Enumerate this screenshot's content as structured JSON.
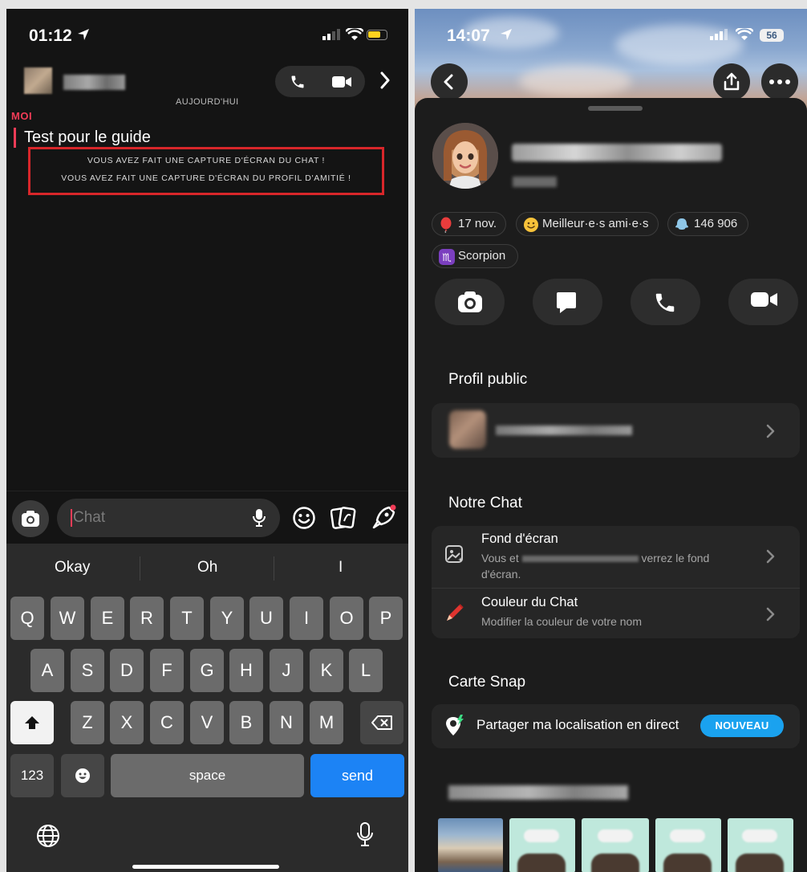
{
  "left_screen": {
    "status": {
      "time": "01:12"
    },
    "chat": {
      "date_label": "AUJOURD'HUI",
      "sender_label": "MOI",
      "message": "Test pour le guide",
      "notice_line1": "VOUS AVEZ FAIT UNE CAPTURE D'ÉCRAN DU CHAT !",
      "notice_line2": "VOUS AVEZ FAIT UNE CAPTURE D'ÉCRAN DU PROFIL D'AMITIÉ !"
    },
    "input": {
      "placeholder": "Chat"
    },
    "keyboard": {
      "suggestions": [
        "Okay",
        "Oh",
        "I"
      ],
      "row1": [
        "Q",
        "W",
        "E",
        "R",
        "T",
        "Y",
        "U",
        "I",
        "O",
        "P"
      ],
      "row2": [
        "A",
        "S",
        "D",
        "F",
        "G",
        "H",
        "J",
        "K",
        "L"
      ],
      "row3": [
        "Z",
        "X",
        "C",
        "V",
        "B",
        "N",
        "M"
      ],
      "numbers_key": "123",
      "space_key": "space",
      "send_key": "send"
    }
  },
  "right_screen": {
    "status": {
      "time": "14:07",
      "battery": "56"
    },
    "profile": {
      "chips": {
        "birthday": "17 nov.",
        "friendship": "Meilleur·e·s ami·e·s",
        "score": "146 906",
        "zodiac": "Scorpion"
      }
    },
    "sections": {
      "public_profile": "Profil public",
      "our_chat": "Notre Chat",
      "snap_map": "Carte Snap"
    },
    "wallpaper": {
      "title": "Fond d'écran",
      "sub_prefix": "Vous et",
      "sub_suffix": "verrez le fond",
      "sub_line2": "d'écran."
    },
    "chat_color": {
      "title": "Couleur du Chat",
      "sub": "Modifier la couleur de votre nom"
    },
    "live_location": {
      "label": "Partager ma localisation en direct",
      "badge": "NOUVEAU"
    },
    "colors": {
      "accent_red": "#f23c57",
      "badge_blue": "#1aa2ef",
      "send_blue": "#1c83f5"
    }
  }
}
